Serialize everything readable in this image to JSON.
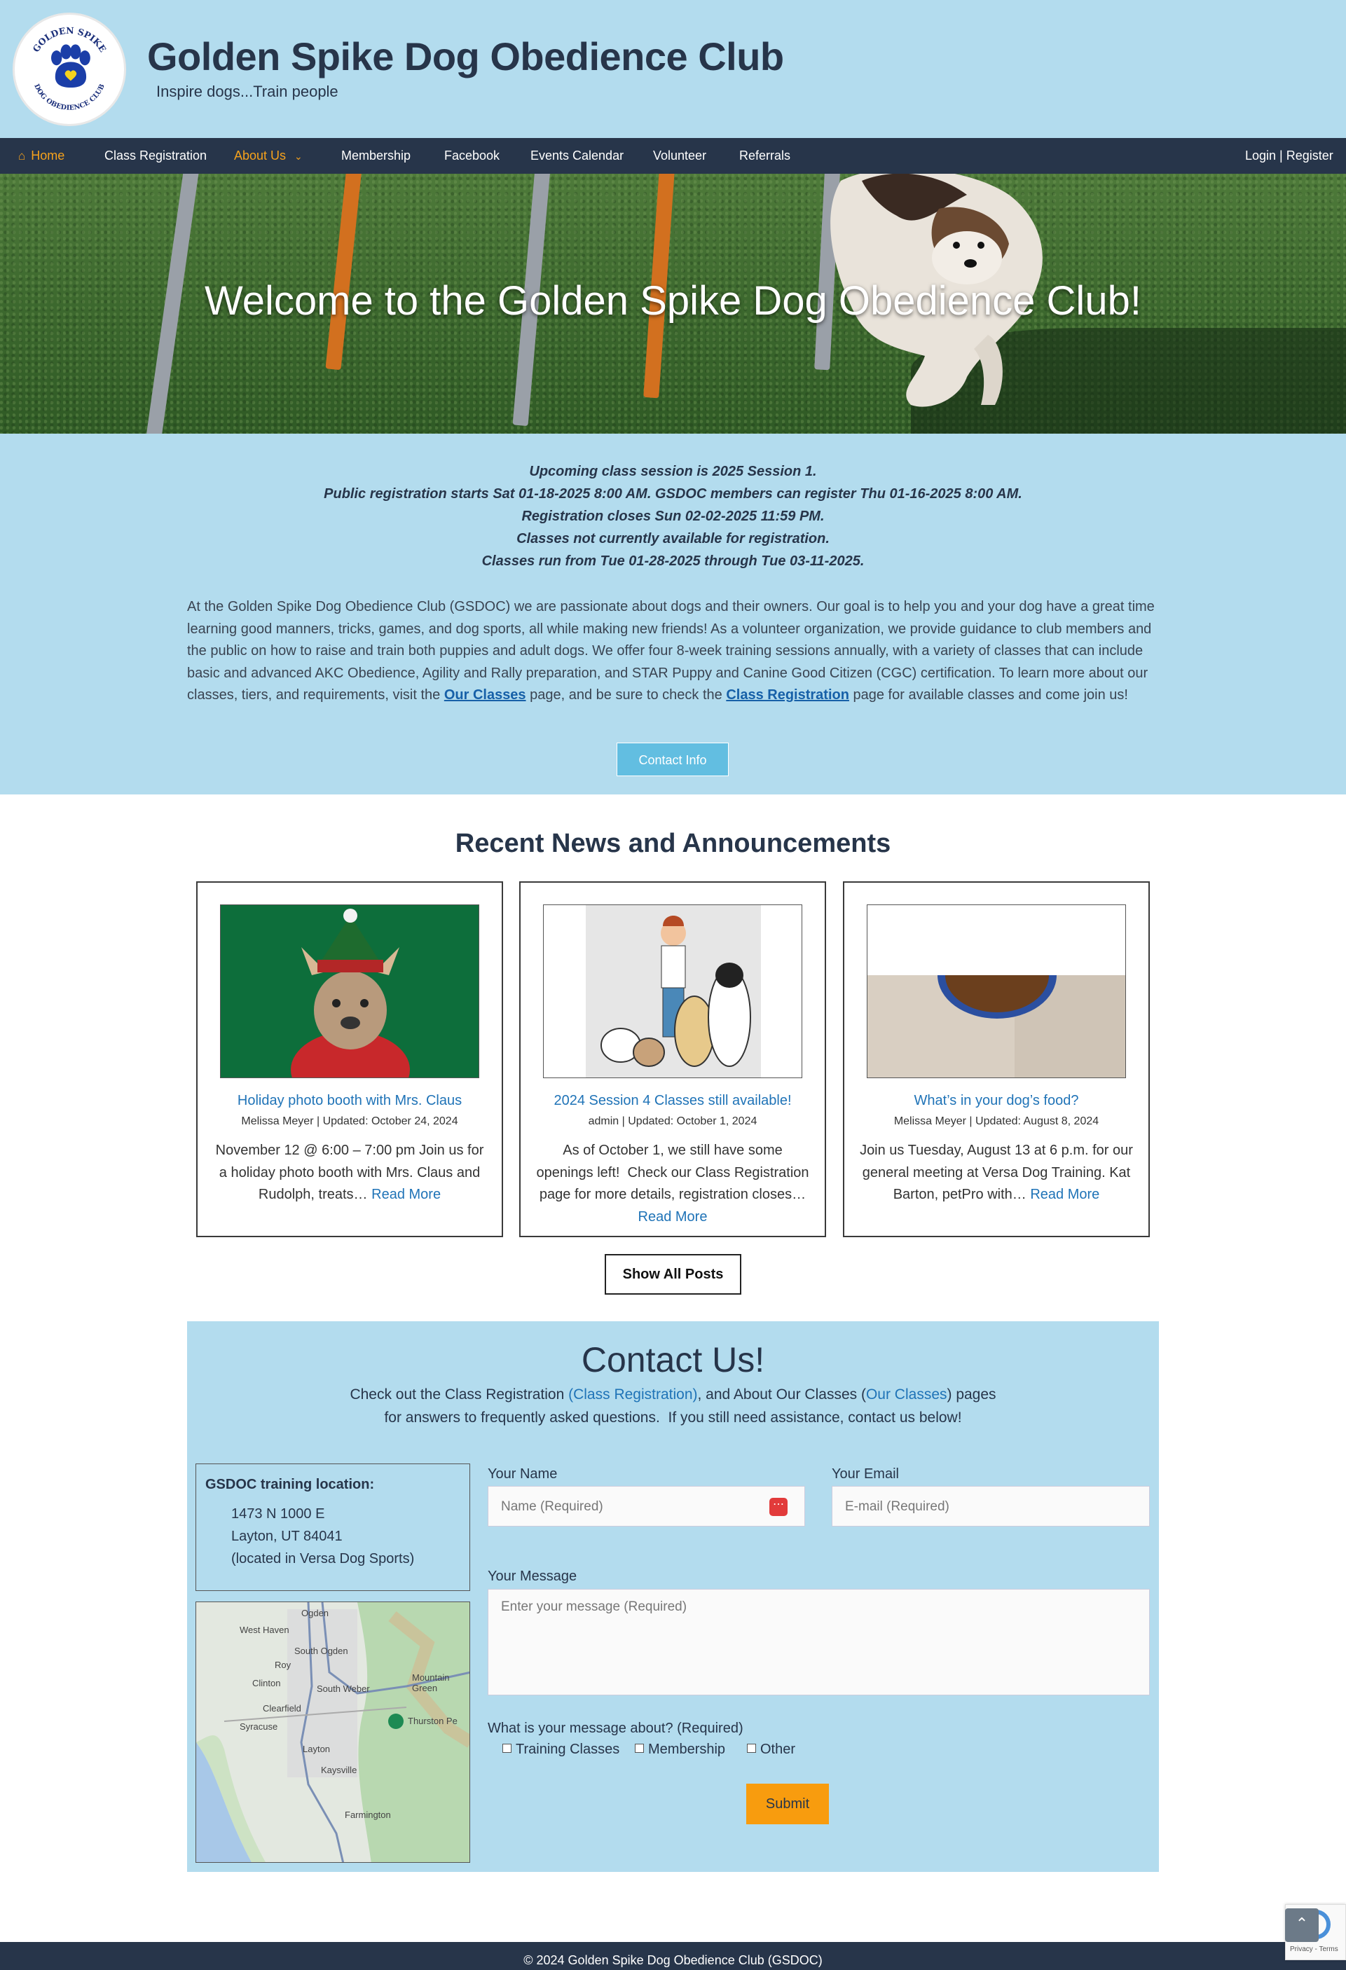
{
  "header": {
    "title": "Golden Spike Dog Obedience Club",
    "tagline": "Inspire dogs...Train people",
    "logo_text_top": "GOLDEN SPIKE",
    "logo_text_bottom": "DOG OBEDIENCE CLUB"
  },
  "nav": {
    "items": [
      {
        "label": "Home",
        "icon": "home-icon"
      },
      {
        "label": "Class Registration"
      },
      {
        "label": "About Us",
        "icon": "chevron-down-icon"
      },
      {
        "label": "Membership"
      },
      {
        "label": "Facebook"
      },
      {
        "label": "Events Calendar"
      },
      {
        "label": "Volunteer"
      },
      {
        "label": "Referrals"
      }
    ],
    "login": "Login | Register",
    "active_color": "#f6a21c"
  },
  "hero": {
    "title": "Welcome to the Golden Spike Dog Obedience Club!"
  },
  "session": {
    "lines": [
      "Upcoming class session is 2025 Session 1.",
      "Public registration starts Sat 01-18-2025 8:00 AM. GSDOC members can register Thu 01-16-2025 8:00 AM.",
      "Registration closes Sun 02-02-2025 11:59 PM.",
      "Classes not currently available for registration.",
      "Classes run from Tue 01-28-2025 through Tue 03-11-2025."
    ]
  },
  "intro": {
    "text_1": "At the Golden Spike Dog Obedience Club (GSDOC) we are passionate about dogs and their owners. Our goal is to help you and your dog have a great time learning good manners, tricks, games, and dog sports, all while making new friends! As a volunteer organization, we provide guidance to club members and the public on how to raise and train both puppies and adult dogs. We offer four 8-week training sessions annually, with a variety of classes that can include basic and advanced AKC Obedience, Agility and Rally preparation, and STAR Puppy and Canine Good Citizen (CGC) certification. To learn more about our classes, tiers, and requirements, visit the ",
    "link_1": "Our Classes",
    "text_2": " page, and be sure to check the ",
    "link_2": "Class Registration",
    "text_3": " page for available classes and come join us!",
    "button": "Contact Info"
  },
  "news": {
    "heading": "Recent News and Announcements",
    "posts": [
      {
        "title": "Holiday photo booth with Mrs. Claus",
        "meta": "Melissa Meyer | Updated: October 24, 2024",
        "excerpt": "November 12 @ 6:00 – 7:00 pm Join us for a holiday photo booth with Mrs. Claus and Rudolph, treats…",
        "read_more": "Read More"
      },
      {
        "title": "2024 Session 4 Classes still available!",
        "meta": "admin | Updated: October 1, 2024",
        "excerpt": "As of October 1, we still have some openings left!  Check our Class Registration page for more details, registration closes…",
        "read_more": "Read More"
      },
      {
        "title": "What’s in your dog’s food?",
        "meta": "Melissa Meyer | Updated: August 8, 2024",
        "excerpt": "Join us Tuesday, August 13 at 6 p.m. for our general meeting at Versa Dog Training. Kat Barton, petPro with…",
        "read_more": "Read More"
      }
    ],
    "show_all": "Show All Posts"
  },
  "contact": {
    "title": "Contact Us!",
    "sub_1": "Check out the Class Registration ",
    "sub_link_1": "(Class Registration)",
    "sub_2": ", and About Our Classes (",
    "sub_link_2": "Our Classes",
    "sub_3": ") pages",
    "sub_line_2": "for answers to frequently asked questions.  If you still need assistance, contact us below!",
    "location": {
      "title": "GSDOC training location:",
      "line_1": "1473 N 1000 E",
      "line_2": "Layton, UT 84041",
      "line_3": "(located in Versa Dog Sports)"
    },
    "map_labels": [
      "Ogden",
      "West Haven",
      "South Ogden",
      "Roy",
      "Clinton",
      "South Weber",
      "Mountain Green",
      "Clearfield",
      "Thurston Pe",
      "Syracuse",
      "Layton",
      "Kaysville",
      "Farmington"
    ],
    "form": {
      "name_label": "Your Name",
      "name_placeholder": "Name (Required)",
      "email_label": "Your Email",
      "email_placeholder": "E-mail (Required)",
      "message_label": "Your Message",
      "message_placeholder": "Enter your message (Required)",
      "topic_label": "What is your message about? (Required)",
      "topics": [
        "Training Classes",
        "Membership",
        "Other"
      ],
      "submit": "Submit"
    }
  },
  "footer": {
    "text": "© 2024 Golden Spike Dog Obedience Club (GSDOC)"
  },
  "recaptcha": {
    "text": "Privacy - Terms"
  }
}
